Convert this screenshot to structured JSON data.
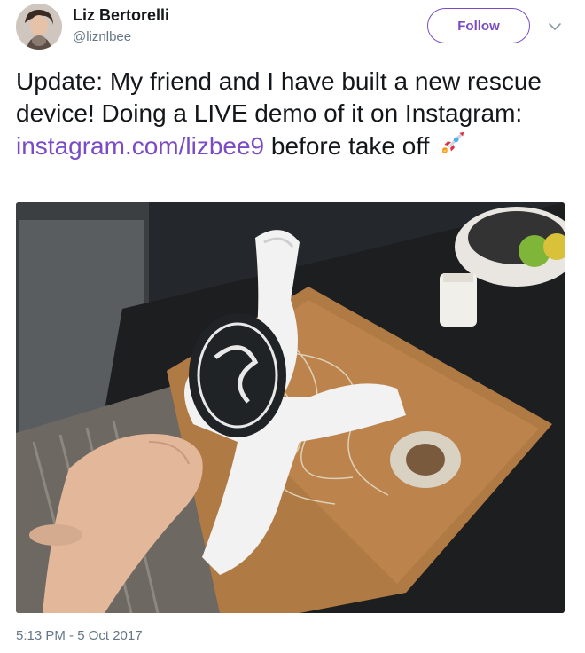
{
  "user": {
    "display_name": "Liz Bertorelli",
    "handle": "@liznlbee",
    "avatar_icon": "profile-photo"
  },
  "follow_label": "Follow",
  "tweet": {
    "text_before": "Update: My friend and I have built a new rescue device! Doing a LIVE demo of it on Instagram: ",
    "link_text": "instagram.com/lizbee9",
    "text_after": " before take off ",
    "emoji_icon": "rocket-icon",
    "link_color": "#794bc4"
  },
  "media": {
    "alt_icon": "photo-drone-on-cutting-board"
  },
  "timestamp": "5:13 PM - 5 Oct 2017"
}
